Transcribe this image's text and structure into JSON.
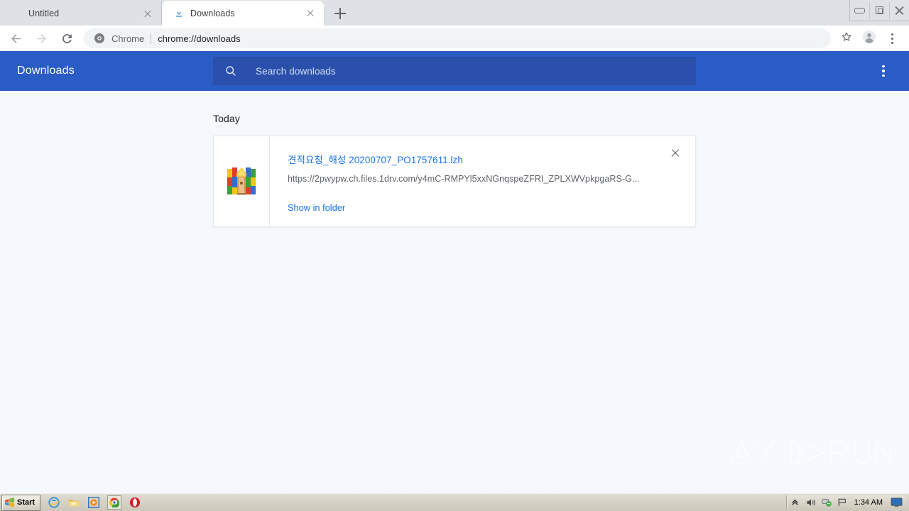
{
  "window": {
    "controls": [
      {
        "name": "minimize",
        "label": "Minimize"
      },
      {
        "name": "restore",
        "label": "Restore"
      },
      {
        "name": "close",
        "label": "Close"
      }
    ]
  },
  "tabs": [
    {
      "title": "Untitled",
      "favicon": "none",
      "active": false,
      "close_label": "Close tab"
    },
    {
      "title": "Downloads",
      "favicon": "download-icon",
      "active": true,
      "close_label": "Close tab"
    }
  ],
  "newtab": {
    "label": "New tab",
    "icon": "plus-icon"
  },
  "toolbar": {
    "back": {
      "icon": "arrow-back-icon",
      "label": "Back"
    },
    "forward": {
      "icon": "arrow-forward-icon",
      "label": "Forward"
    },
    "reload": {
      "icon": "reload-icon",
      "label": "Reload"
    },
    "omnibox": {
      "icon": "chrome-logo-icon",
      "scheme_label": "Chrome",
      "url": "chrome://downloads"
    },
    "bookmark": {
      "icon": "star-icon",
      "label": "Bookmark this page"
    },
    "profile": {
      "icon": "account-avatar-icon",
      "label": "Profile"
    },
    "menu": {
      "icon": "kebab-menu-icon",
      "label": "Customize and control Google Chrome"
    }
  },
  "downloads_page": {
    "title": "Downloads",
    "search": {
      "icon": "search-icon",
      "placeholder": "Search downloads",
      "value": ""
    },
    "menu": {
      "icon": "kebab-menu-icon",
      "label": "More actions"
    },
    "group_title": "Today",
    "items": [
      {
        "file_icon": "winrar-archive-icon",
        "filename": "견적요청_해성 20200707_PO1757611.lzh",
        "url": "https://2pwypw.ch.files.1drv.com/y4mC-RMPYl5xxNGnqspeZFRI_ZPLXWVpkpgaRS-G...",
        "action_label": "Show in folder",
        "remove_label": "Remove from list"
      }
    ]
  },
  "watermark": {
    "text": "ANY RUN"
  },
  "taskbar": {
    "start": {
      "label": "Start",
      "icon": "windows-flag-icon"
    },
    "quick_launch": [
      {
        "name": "internet-explorer-icon",
        "label": "Internet Explorer",
        "active": false
      },
      {
        "name": "file-explorer-icon",
        "label": "File Explorer",
        "active": false
      },
      {
        "name": "media-player-icon",
        "label": "Windows Media Player",
        "active": false
      },
      {
        "name": "chrome-icon",
        "label": "Google Chrome",
        "active": true
      },
      {
        "name": "opera-icon",
        "label": "Opera",
        "active": false
      }
    ],
    "tray": [
      {
        "name": "show-hidden-icons-icon",
        "label": "Show hidden icons"
      },
      {
        "name": "volume-icon",
        "label": "Volume"
      },
      {
        "name": "network-icon",
        "label": "Network"
      },
      {
        "name": "flag-icon",
        "label": "Action center"
      }
    ],
    "clock": "1:34 AM",
    "show-desktop": {
      "name": "show-desktop-icon",
      "label": "Show desktop"
    }
  },
  "colors": {
    "downloads_header": "#2b5bc4",
    "search_field": "#2a50ab",
    "link": "#1a73e8",
    "tabstrip": "#dee1e6",
    "content_bg": "#f5f8fc"
  }
}
